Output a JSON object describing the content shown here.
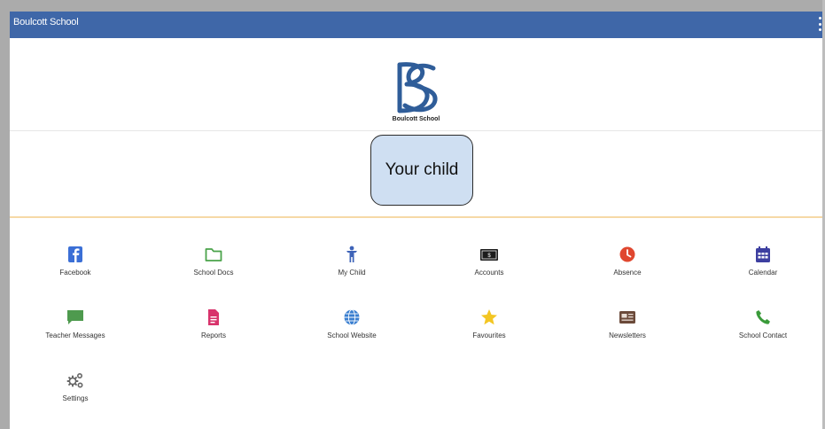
{
  "appbar": {
    "title": "Boulcott School"
  },
  "logo": {
    "caption": "Boulcott School",
    "monogram": "BS"
  },
  "child_button": {
    "label": "Your child"
  },
  "colors": {
    "appbar": "#3f67a8",
    "button_bg": "#cfdff2",
    "divider_accent": "#f6d9a6"
  },
  "tiles": [
    {
      "label": "Facebook",
      "icon": "facebook-icon"
    },
    {
      "label": "School Docs",
      "icon": "folder-icon"
    },
    {
      "label": "My Child",
      "icon": "child-icon"
    },
    {
      "label": "Accounts",
      "icon": "money-icon"
    },
    {
      "label": "Absence",
      "icon": "clock-icon"
    },
    {
      "label": "Calendar",
      "icon": "calendar-icon"
    },
    {
      "label": "Teacher Messages",
      "icon": "message-icon"
    },
    {
      "label": "Reports",
      "icon": "report-icon"
    },
    {
      "label": "School Website",
      "icon": "globe-icon"
    },
    {
      "label": "Favourites",
      "icon": "star-icon"
    },
    {
      "label": "Newsletters",
      "icon": "newsletter-icon"
    },
    {
      "label": "School Contact",
      "icon": "phone-icon"
    },
    {
      "label": "Settings",
      "icon": "gears-icon"
    }
  ]
}
